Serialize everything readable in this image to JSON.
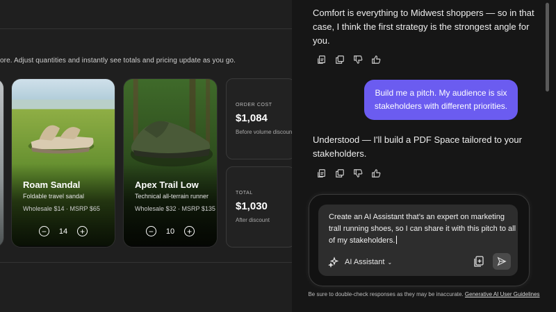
{
  "document": {
    "intro_text": "ore. Adjust quantities and instantly see totals and pricing update as you go.",
    "products": [
      {
        "name": "Roam Sandal",
        "description": "Foldable travel sandal",
        "pricing": "Wholesale $14 ·  MSRP $65",
        "quantity": "14"
      },
      {
        "name": "Apex Trail Low",
        "description": "Technical all-terrain runner",
        "pricing": "Wholesale $32 ·  MSRP $135",
        "quantity": "10"
      }
    ],
    "order_cost": {
      "label": "ORDER COST",
      "value": "$1,084",
      "sub": "Before volume discount"
    },
    "total": {
      "label": "TOTAL",
      "value": "$1,030",
      "sub": "After discount"
    }
  },
  "chat": {
    "messages": [
      {
        "role": "assistant",
        "text": "Comfort is everything to Midwest shoppers — so in that case, I think the first strategy is the strongest angle for you."
      },
      {
        "role": "user",
        "text": "Build me a pitch. My audience is six stakeholders with different priorities."
      },
      {
        "role": "assistant",
        "text": "Understood — I'll build a PDF Space tailored to your stakeholders."
      }
    ],
    "composer": {
      "text": "Create an AI Assistant that’s an expert on marketing trall running shoes, so I can share it with this pitch to all of my stakeholders.",
      "assistant_label": "AI Assistant"
    },
    "disclaimer": "Be sure to double-check responses as they may be inaccurate.",
    "disclaimer_link": "Generative AI User Guidelines"
  },
  "colors": {
    "accent": "#6b5cf0",
    "background": "#161616"
  }
}
